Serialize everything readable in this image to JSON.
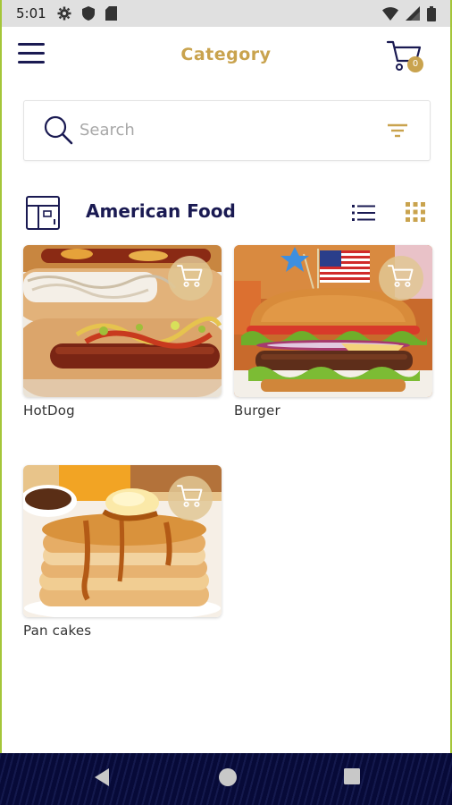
{
  "status_bar": {
    "time": "5:01",
    "icons": [
      "gear-icon",
      "shield-icon",
      "sd-card-icon",
      "wifi-icon",
      "signal-icon",
      "battery-icon"
    ]
  },
  "app_bar": {
    "title": "Category",
    "cart_count": "0",
    "menu_icon": "hamburger-icon",
    "cart_icon": "cart-icon"
  },
  "search": {
    "placeholder": "Search",
    "value": ""
  },
  "category": {
    "title": "American Food",
    "list_view_icon": "list-view-icon",
    "grid_view_icon": "grid-view-icon"
  },
  "products": [
    {
      "name": "HotDog"
    },
    {
      "name": "Burger"
    },
    {
      "name": "Pan cakes"
    }
  ],
  "colors": {
    "accent_gold": "#c9a34e",
    "primary_navy": "#1a1a52",
    "nav_bar": "#070a38",
    "status_bar": "#e0e0e0"
  }
}
